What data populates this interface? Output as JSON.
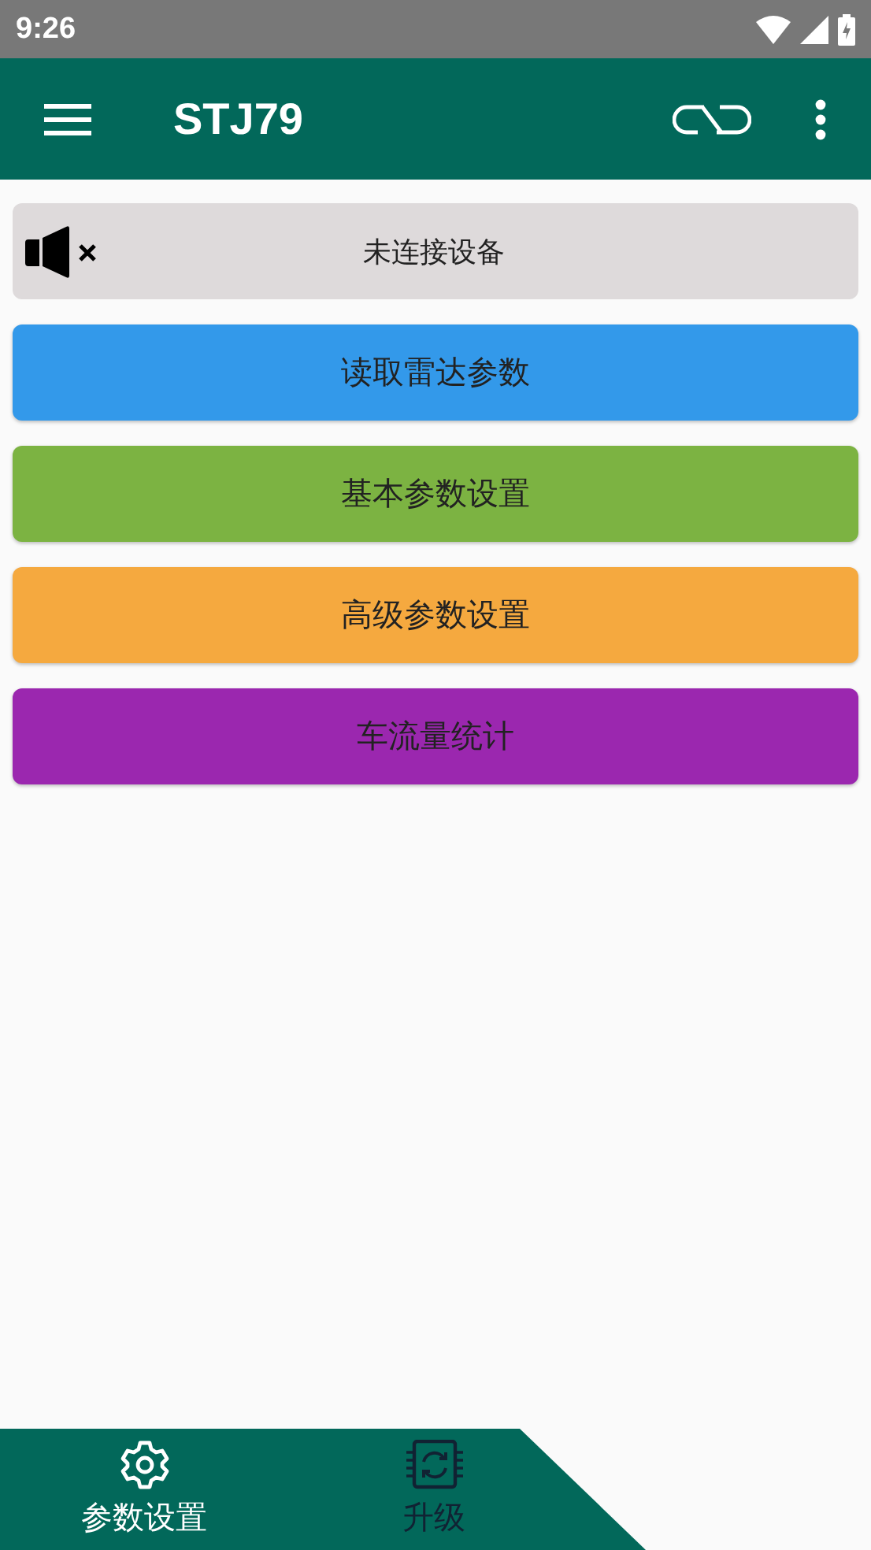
{
  "status_bar": {
    "time": "9:26"
  },
  "app_bar": {
    "title": "STJ79"
  },
  "connection": {
    "muted": true,
    "text": "未连接设备"
  },
  "actions": [
    {
      "label": "读取雷达参数",
      "color": "#3399ea"
    },
    {
      "label": "基本参数设置",
      "color": "#7cb342"
    },
    {
      "label": "高级参数设置",
      "color": "#f5a93f"
    },
    {
      "label": "车流量统计",
      "color": "#9b27af"
    }
  ],
  "bottom_nav": [
    {
      "label": "参数设置",
      "kind": "gear",
      "selected": true
    },
    {
      "label": "升级",
      "kind": "chip",
      "selected": false
    }
  ]
}
